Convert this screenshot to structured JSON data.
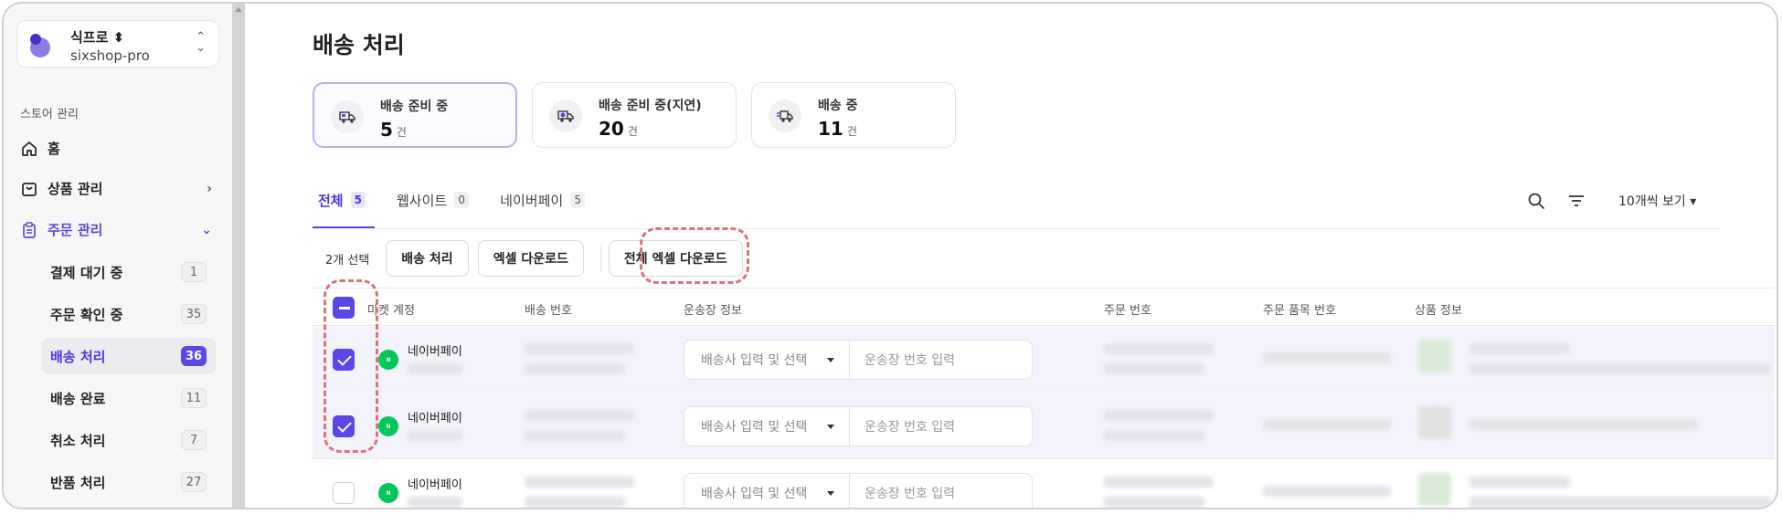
{
  "store": {
    "name": "식프로 ⬍",
    "id": "sixshop-pro"
  },
  "sidebar": {
    "section_title": "스토어 관리",
    "items": [
      {
        "label": "홈"
      },
      {
        "label": "상품 관리"
      },
      {
        "label": "주문 관리"
      }
    ],
    "sub_items": [
      {
        "label": "결제 대기 중",
        "count": "1"
      },
      {
        "label": "주문 확인 중",
        "count": "35"
      },
      {
        "label": "배송 처리",
        "count": "36"
      },
      {
        "label": "배송 완료",
        "count": "11"
      },
      {
        "label": "취소 처리",
        "count": "7"
      },
      {
        "label": "반품 처리",
        "count": "27"
      }
    ]
  },
  "page": {
    "title": "배송 처리"
  },
  "summary_cards": [
    {
      "label": "배송 준비 중",
      "value": "5",
      "unit": "건"
    },
    {
      "label": "배송 준비 중(지연)",
      "value": "20",
      "unit": "건"
    },
    {
      "label": "배송 중",
      "value": "11",
      "unit": "건"
    }
  ],
  "tabs": [
    {
      "label": "전체",
      "count": "5"
    },
    {
      "label": "웹사이트",
      "count": "0"
    },
    {
      "label": "네이버페이",
      "count": "5"
    }
  ],
  "per_page": "10개씩 보기 ▾",
  "toolbar": {
    "selection": "2개 선택",
    "ship_button": "배송 처리",
    "excel_button": "엑셀 다운로드",
    "all_excel_button": "전체 엑셀 다운로드"
  },
  "table": {
    "columns": [
      "마켓 계정",
      "배송 번호",
      "운송장 정보",
      "주문 번호",
      "주문 품목 번호",
      "상품 정보"
    ],
    "rows": [
      {
        "market": "네이버페이",
        "carrier_placeholder": "배송사 입력 및 선택",
        "tracking_placeholder": "운송장 번호 입력",
        "checked": true
      },
      {
        "market": "네이버페이",
        "carrier_placeholder": "배송사 입력 및 선택",
        "tracking_placeholder": "운송장 번호 입력",
        "checked": true
      },
      {
        "market": "네이버페이",
        "carrier_placeholder": "배송사 입력 및 선택",
        "tracking_placeholder": "운송장 번호 입력",
        "checked": false
      }
    ]
  },
  "colors": {
    "accent": "#5b46e6",
    "naver": "#03c75a",
    "highlight": "#e0707c"
  }
}
